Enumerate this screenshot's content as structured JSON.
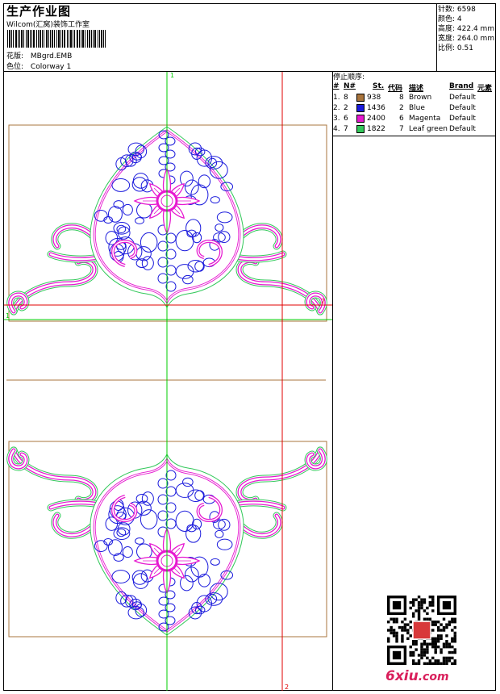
{
  "header": {
    "title": "生产作业图",
    "company": "Wilcom(汇窝)装饰工作室",
    "design_label": "花版:",
    "design_value": "MBgrd.EMB",
    "colorway_label": "色位:",
    "colorway_value": "Colorway 1"
  },
  "info": [
    {
      "label": "针数:",
      "value": "6598"
    },
    {
      "label": "颜色:",
      "value": "4"
    },
    {
      "label": "高度:",
      "value": "422.4 mm"
    },
    {
      "label": "宽度:",
      "value": "264.0 mm"
    },
    {
      "label": "比例:",
      "value": "0.51"
    }
  ],
  "stop_sequence": {
    "header": "停止顺序:",
    "columns": [
      "#",
      "N#",
      "St.",
      "代码",
      "描述",
      "Brand",
      "元素"
    ],
    "rows": [
      {
        "idx": "1.",
        "n": "8",
        "color": "#a8743c",
        "st": "938",
        "code": "8",
        "desc": "Brown",
        "brand": "Default"
      },
      {
        "idx": "2.",
        "n": "2",
        "color": "#1a1adc",
        "st": "1436",
        "code": "2",
        "desc": "Blue",
        "brand": "Default"
      },
      {
        "idx": "3.",
        "n": "6",
        "color": "#e619d0",
        "st": "2400",
        "code": "6",
        "desc": "Magenta",
        "brand": "Default"
      },
      {
        "idx": "4.",
        "n": "7",
        "color": "#32c85a",
        "st": "1822",
        "code": "7",
        "desc": "Leaf green",
        "brand": "Default"
      }
    ]
  },
  "guides": {
    "mark_1": "1",
    "mark_2": "2"
  },
  "watermark": {
    "text": "6xiu",
    "suffix": ".com"
  },
  "colors": {
    "frame": "#000000",
    "guide_green": "#00cc00",
    "guide_red": "#e00000",
    "hoop_brown": "#a8743c",
    "stitch_blue": "#1a1adc",
    "stitch_magenta": "#e619d0",
    "stitch_green": "#32c85a"
  }
}
